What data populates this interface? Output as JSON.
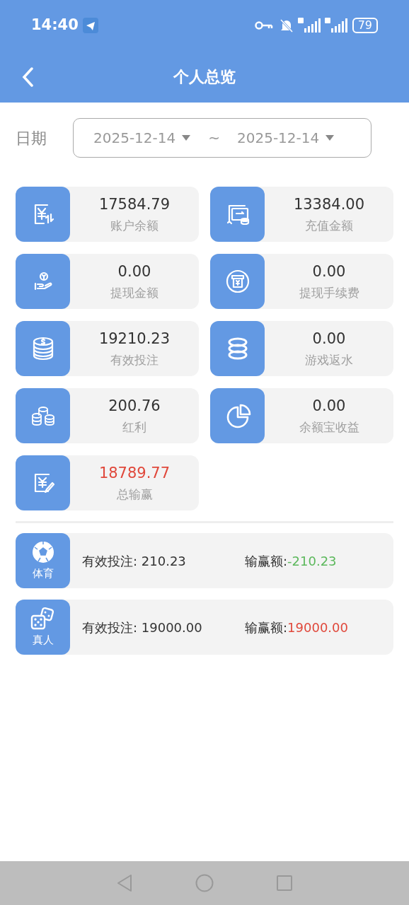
{
  "status_bar": {
    "time": "14:40",
    "battery": "79"
  },
  "header": {
    "title": "个人总览"
  },
  "date_filter": {
    "label": "日期",
    "start": "2025-12-14",
    "separator": "~",
    "end": "2025-12-14"
  },
  "stats": [
    {
      "value": "17584.79",
      "label": "账户余额",
      "color": "#333333"
    },
    {
      "value": "13384.00",
      "label": "充值金额",
      "color": "#333333"
    },
    {
      "value": "0.00",
      "label": "提现金额",
      "color": "#333333"
    },
    {
      "value": "0.00",
      "label": "提现手续费",
      "color": "#333333"
    },
    {
      "value": "19210.23",
      "label": "有效投注",
      "color": "#333333"
    },
    {
      "value": "0.00",
      "label": "游戏返水",
      "color": "#333333"
    },
    {
      "value": "200.76",
      "label": "红利",
      "color": "#333333"
    },
    {
      "value": "0.00",
      "label": "余额宝收益",
      "color": "#333333"
    },
    {
      "value": "18789.77",
      "label": "总输赢",
      "color": "#e0483b"
    }
  ],
  "games": [
    {
      "name": "体育",
      "bet_label": "有效投注:",
      "bet": "210.23",
      "result_label": "输赢额:",
      "result": "-210.23",
      "color": "#5cb85c"
    },
    {
      "name": "真人",
      "bet_label": "有效投注:",
      "bet": "19000.00",
      "result_label": "输赢额:",
      "result": "19000.00",
      "color": "#e0483b"
    }
  ]
}
